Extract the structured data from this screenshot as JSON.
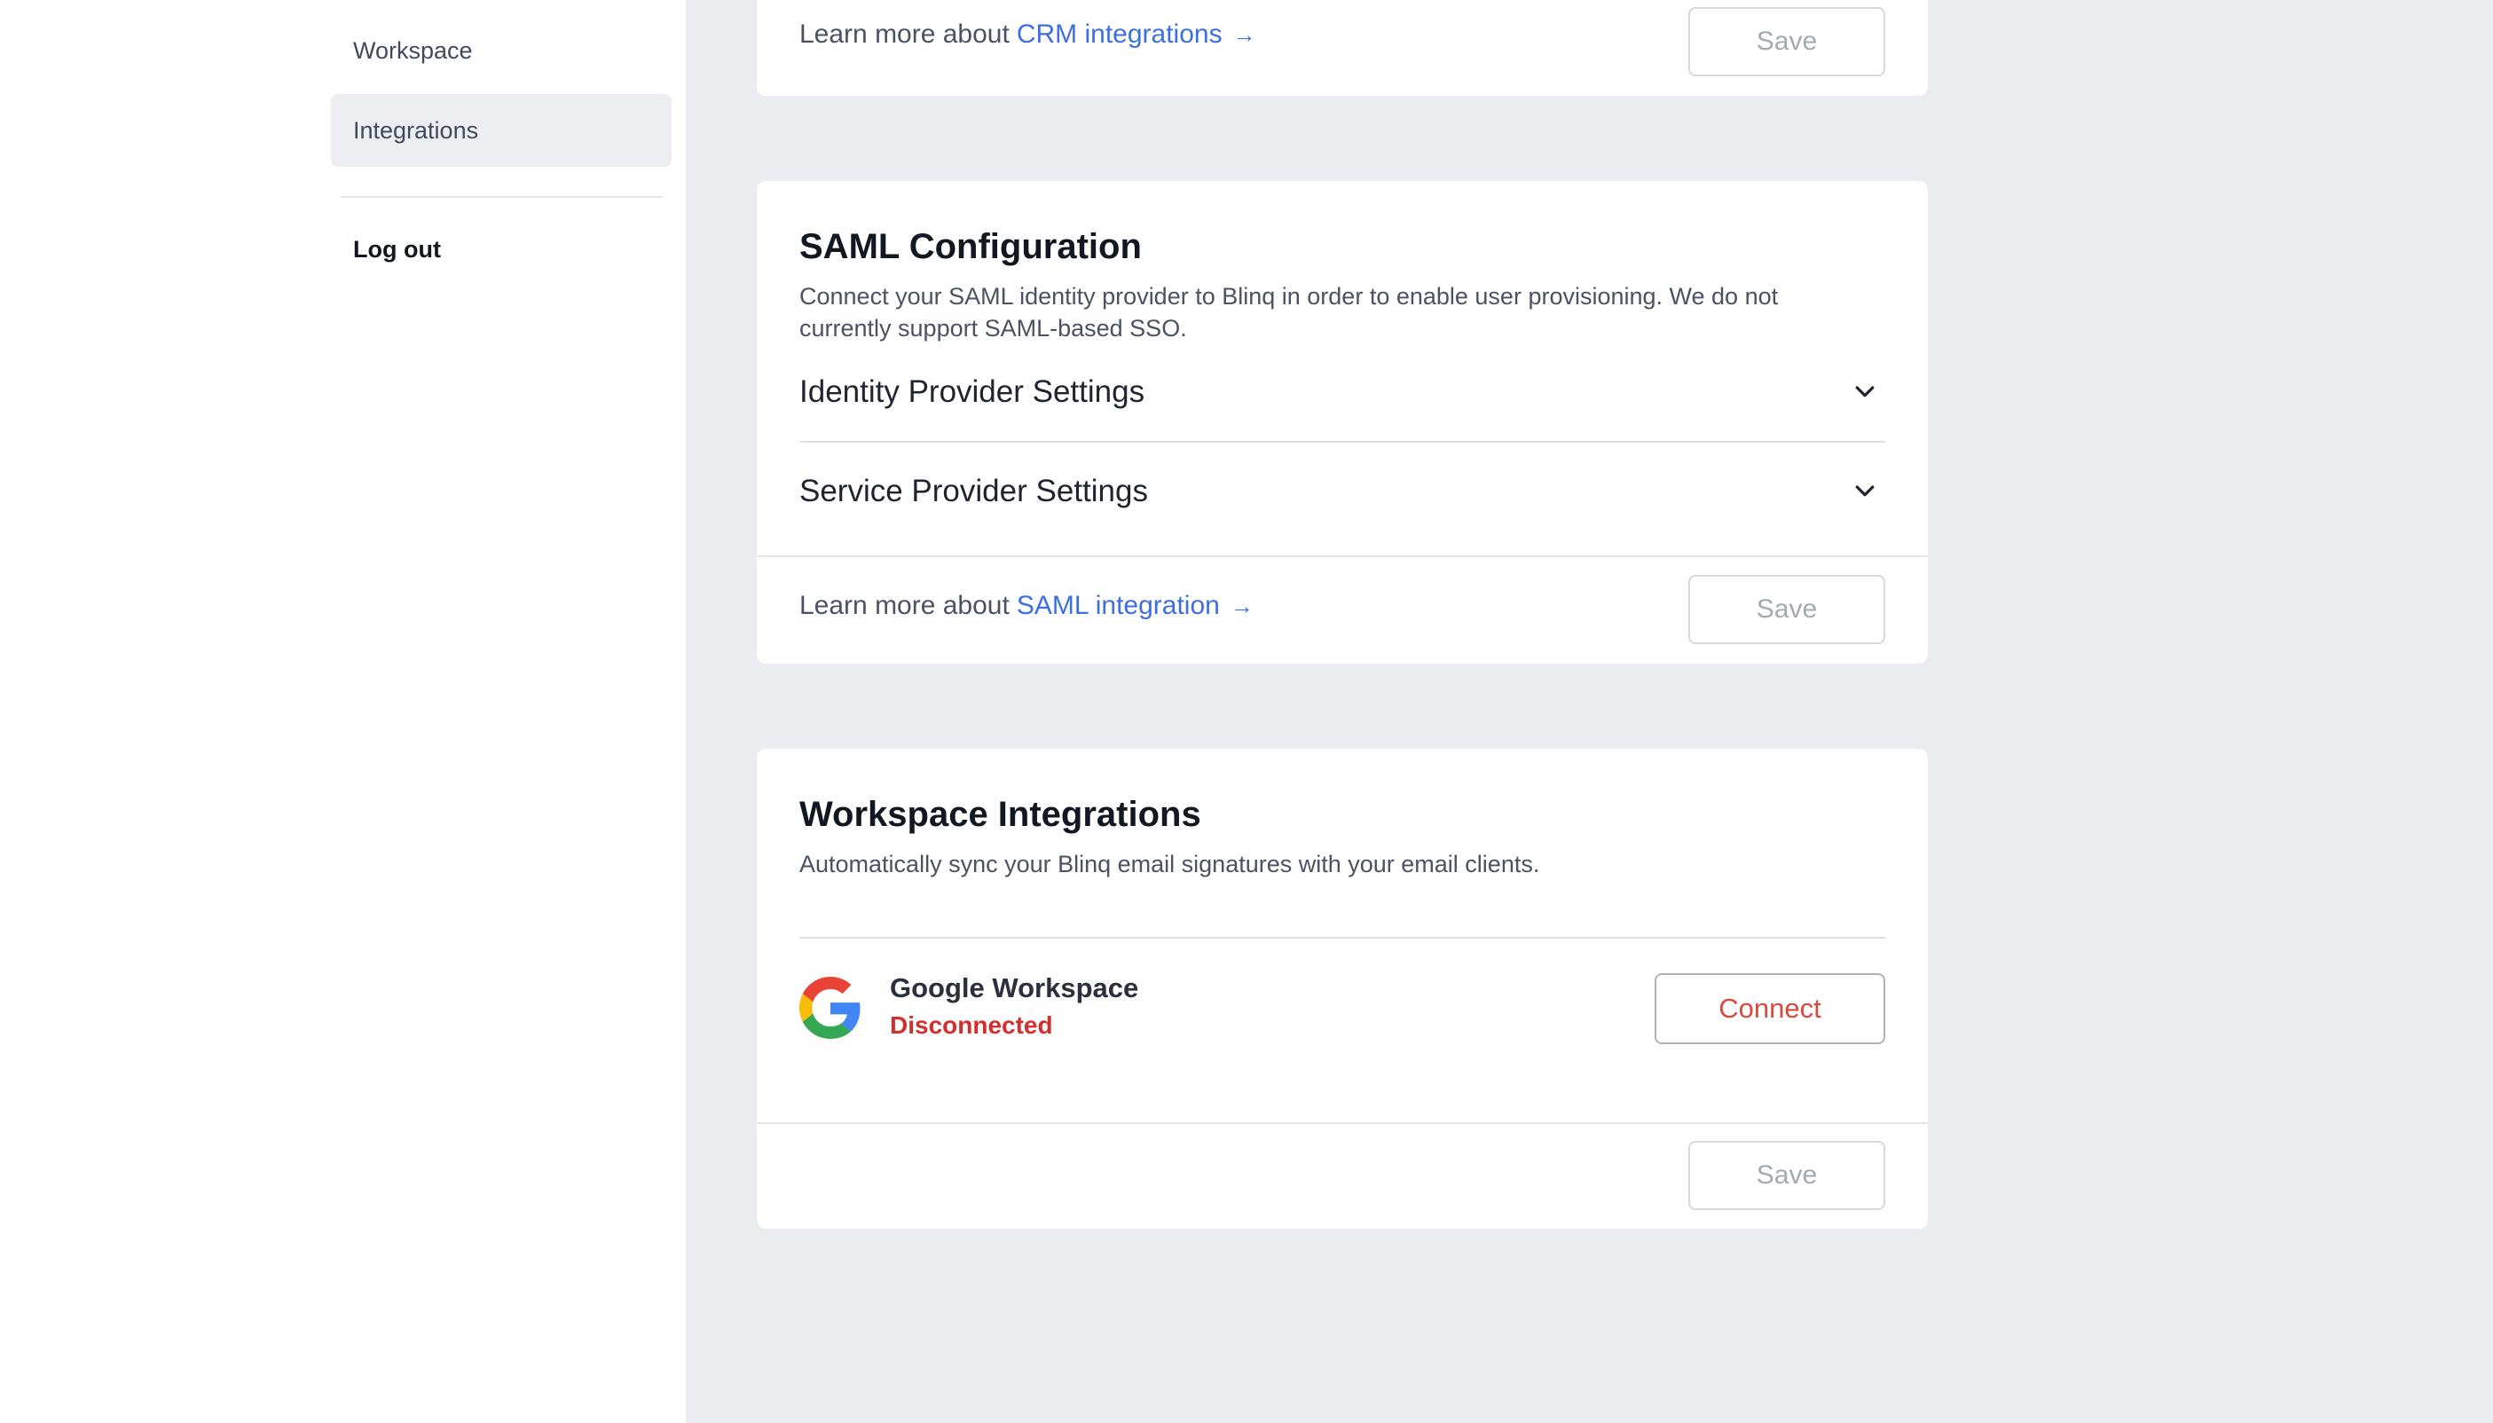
{
  "sidebar": {
    "items": [
      {
        "label": "Workspace",
        "active": false
      },
      {
        "label": "Integrations",
        "active": true
      }
    ],
    "logout_label": "Log out"
  },
  "crm_card": {
    "learn_prefix": "Learn more about",
    "learn_link": "CRM integrations",
    "arrow": "→",
    "save_label": "Save"
  },
  "saml_card": {
    "title": "SAML Configuration",
    "description": "Connect your SAML identity provider to Blinq in order to enable user provisioning. We do not currently support SAML-based SSO.",
    "sections": [
      {
        "label": "Identity Provider Settings",
        "icon": "chevron-down-icon"
      },
      {
        "label": "Service Provider Settings",
        "icon": "chevron-down-icon"
      }
    ],
    "learn_prefix": "Learn more about",
    "learn_link": "SAML integration",
    "arrow": "→",
    "save_label": "Save"
  },
  "workspace_card": {
    "title": "Workspace Integrations",
    "description": "Automatically sync your Blinq email signatures with your email clients.",
    "integration": {
      "name": "Google Workspace",
      "status": "Disconnected",
      "status_color": "#d32f2f",
      "icon": "google-icon",
      "connect_label": "Connect"
    },
    "save_label": "Save"
  },
  "colors": {
    "link": "#3d6fe0",
    "background": "#ebecf0",
    "connect_text": "#d94a3d"
  }
}
